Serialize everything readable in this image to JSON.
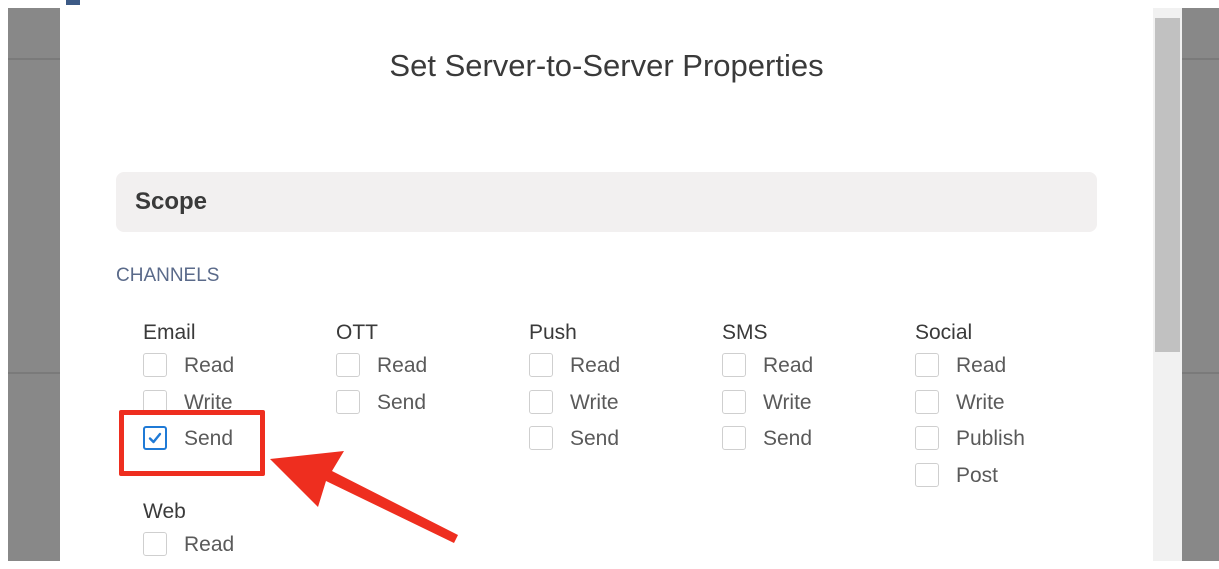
{
  "dialog": {
    "title": "Set Server-to-Server Properties",
    "section_label": "Scope",
    "subsection_label": "CHANNELS"
  },
  "channels": [
    {
      "name": "Email",
      "options": [
        {
          "label": "Read",
          "checked": false
        },
        {
          "label": "Write",
          "checked": false
        },
        {
          "label": "Send",
          "checked": true
        }
      ]
    },
    {
      "name": "OTT",
      "options": [
        {
          "label": "Read",
          "checked": false
        },
        {
          "label": "Send",
          "checked": false
        }
      ]
    },
    {
      "name": "Push",
      "options": [
        {
          "label": "Read",
          "checked": false
        },
        {
          "label": "Write",
          "checked": false
        },
        {
          "label": "Send",
          "checked": false
        }
      ]
    },
    {
      "name": "SMS",
      "options": [
        {
          "label": "Read",
          "checked": false
        },
        {
          "label": "Write",
          "checked": false
        },
        {
          "label": "Send",
          "checked": false
        }
      ]
    },
    {
      "name": "Social",
      "options": [
        {
          "label": "Read",
          "checked": false
        },
        {
          "label": "Write",
          "checked": false
        },
        {
          "label": "Publish",
          "checked": false
        },
        {
          "label": "Post",
          "checked": false
        }
      ]
    },
    {
      "name": "Web",
      "options": [
        {
          "label": "Read",
          "checked": false
        }
      ]
    }
  ],
  "colors": {
    "accent": "#1f7ad6",
    "annotation": "#ee2e1f",
    "backdrop": "#888888"
  },
  "icons": {
    "checkmark": "checkmark-icon",
    "annotation_arrow": "arrow-icon"
  }
}
